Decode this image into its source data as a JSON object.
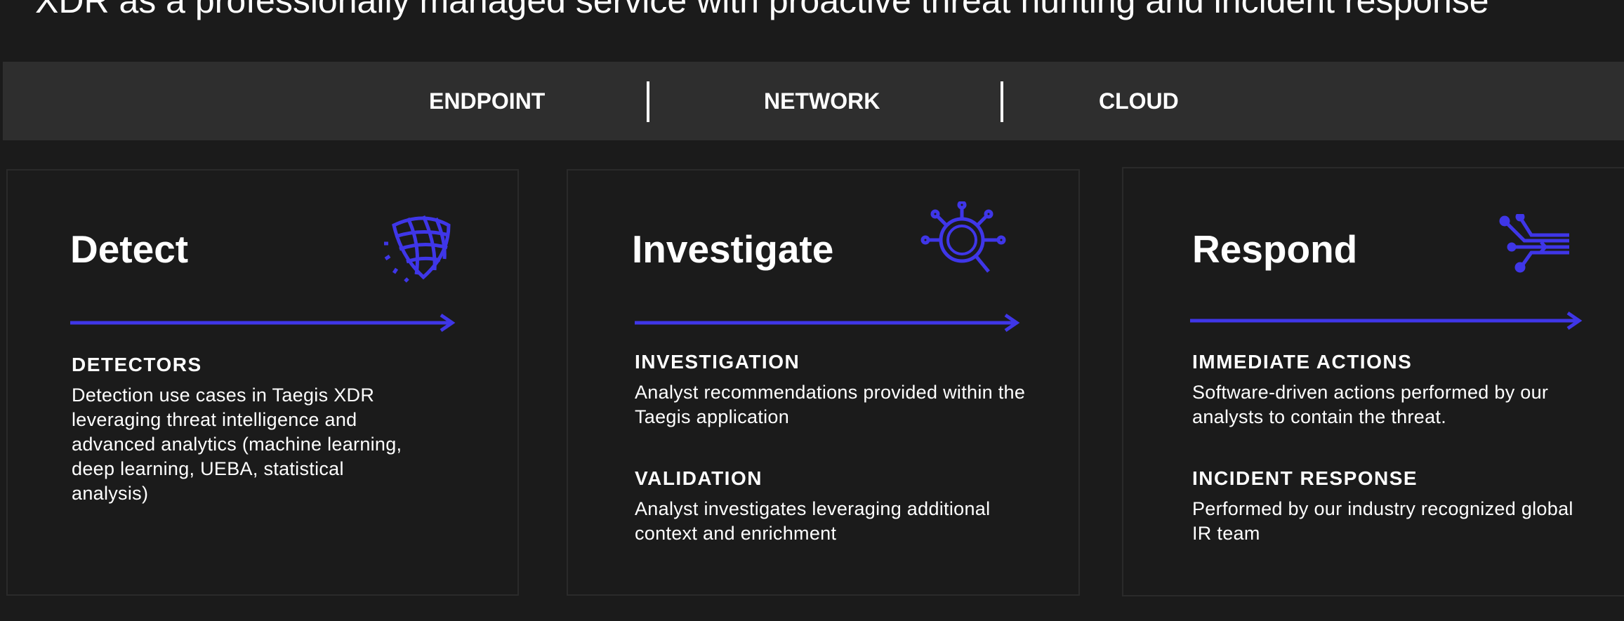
{
  "headline": "XDR as a professionally managed service with proactive threat hunting and incident response",
  "tabs": [
    {
      "label": "ENDPOINT"
    },
    {
      "label": "NETWORK"
    },
    {
      "label": "CLOUD"
    }
  ],
  "accent_color": "#3f36e8",
  "cards": [
    {
      "title": "Detect",
      "icon": "globe-shield-icon",
      "sections": [
        {
          "heading": "DETECTORS",
          "body": "Detection use cases in Taegis XDR leveraging threat intelligence and advanced analytics (machine learning, deep learning, UEBA, statistical analysis)"
        }
      ]
    },
    {
      "title": "Investigate",
      "icon": "magnifier-network-icon",
      "sections": [
        {
          "heading": "INVESTIGATION",
          "body": "Analyst recommendations provided within the Taegis application"
        },
        {
          "heading": "VALIDATION",
          "body": "Analyst investigates leveraging additional context and enrichment"
        }
      ]
    },
    {
      "title": "Respond",
      "icon": "circuit-arrow-icon",
      "sections": [
        {
          "heading": "IMMEDIATE ACTIONS",
          "body": "Software-driven actions performed by our analysts to contain the threat."
        },
        {
          "heading": "INCIDENT RESPONSE",
          "body": "Performed by our industry recognized global IR team"
        }
      ]
    }
  ]
}
